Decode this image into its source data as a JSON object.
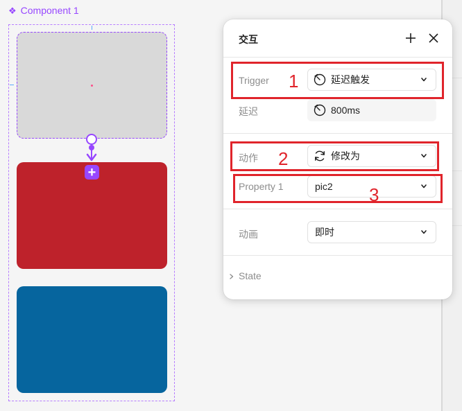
{
  "component": {
    "label": "Component 1",
    "icon": "component-icon"
  },
  "canvas": {
    "cards": [
      {
        "name": "gray-card",
        "color": "#d9d9d9"
      },
      {
        "name": "red-card",
        "color": "#be222b"
      },
      {
        "name": "blue-card",
        "color": "#06659e"
      }
    ],
    "accent_color": "#9747ff"
  },
  "panel": {
    "title": "交互",
    "add_icon": "plus-icon",
    "close_icon": "close-icon",
    "trigger": {
      "label": "Trigger",
      "value": "延迟触发",
      "icon": "timer-icon"
    },
    "delay": {
      "label": "延迟",
      "value": "800ms",
      "icon": "timer-icon"
    },
    "action": {
      "label": "动作",
      "value": "修改为",
      "icon": "refresh-icon"
    },
    "property": {
      "label": "Property 1",
      "value": "pic2"
    },
    "animation": {
      "label": "动画",
      "value": "即时"
    },
    "state": {
      "label": "State"
    }
  },
  "annotations": {
    "color": "#e0242b",
    "numbers": [
      "1",
      "2",
      "3"
    ]
  }
}
